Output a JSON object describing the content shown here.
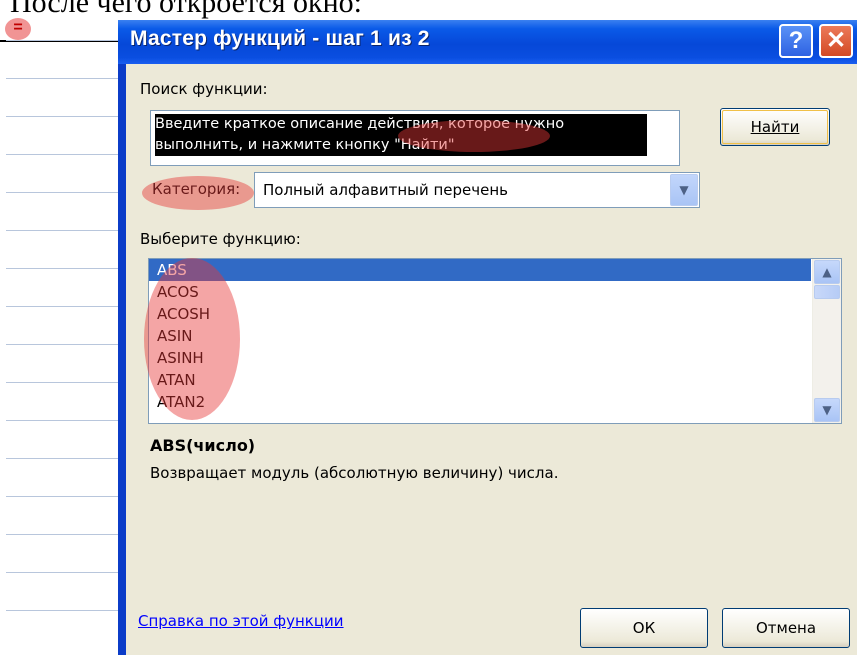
{
  "background": {
    "caption": "После чего откроется окно:",
    "formula_prefix": "="
  },
  "dialog": {
    "title": "Мастер функций - шаг 1 из 2",
    "help_button": "?",
    "close_button": "✕",
    "search": {
      "label": "Поиск функции:",
      "value": "Введите краткое описание действия, которое нужно выполнить, и нажмите кнопку \"Найти\"",
      "find_button": "Найти"
    },
    "category": {
      "label": "Категория:",
      "value": "Полный алфавитный перечень"
    },
    "function_list": {
      "label": "Выберите функцию:",
      "items": [
        "ABS",
        "ACOS",
        "ACOSH",
        "ASIN",
        "ASINH",
        "ATAN",
        "ATAN2"
      ],
      "selected": "ABS"
    },
    "function_signature": "ABS(число)",
    "function_description": "Возвращает модуль (абсолютную величину) числа.",
    "help_link": "Справка по этой функции",
    "ok_button": "ОК",
    "cancel_button": "Отмена"
  },
  "colors": {
    "title_bar": "#0a4ee0",
    "selection": "#316ac5",
    "highlight": "#e63737",
    "link": "#0000ff"
  }
}
